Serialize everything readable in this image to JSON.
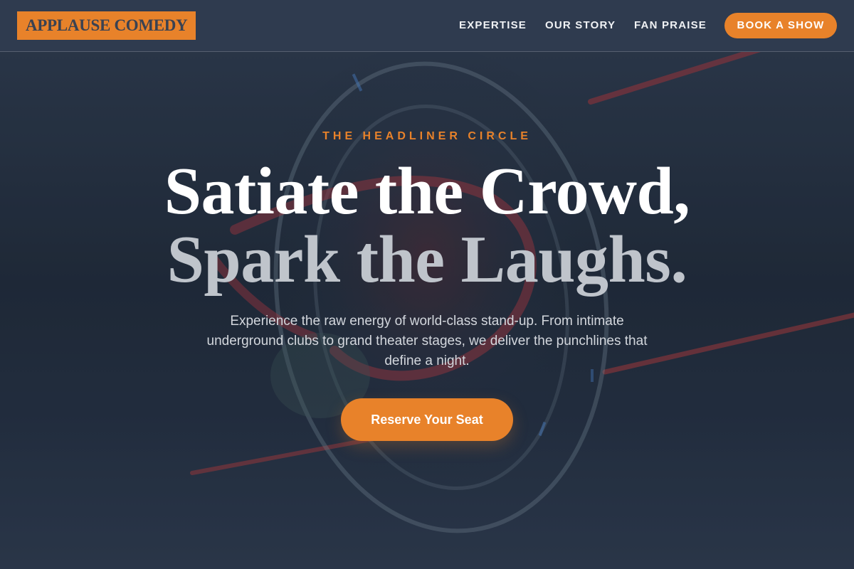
{
  "brand": {
    "logo_text": "APPLAUSE COMEDY"
  },
  "nav": {
    "links": [
      {
        "label": "EXPERTISE"
      },
      {
        "label": "OUR STORY"
      },
      {
        "label": "FAN PRAISE"
      }
    ],
    "cta_label": "BOOK A SHOW"
  },
  "hero": {
    "eyebrow": "THE HEADLINER CIRCLE",
    "headline_line1": "Satiate the Crowd,",
    "headline_line2": "Spark the Laughs.",
    "subtext": "Experience the raw energy of world-class stand-up. From intimate underground clubs to grand theater stages, we deliver the punchlines that define a night.",
    "cta_label": "Reserve Your Seat",
    "background_image": "neon-comedy-club-sign"
  },
  "colors": {
    "accent": "#e8822a",
    "header_bg": "#2f3b4f",
    "hero_bg": "#222d3e"
  }
}
